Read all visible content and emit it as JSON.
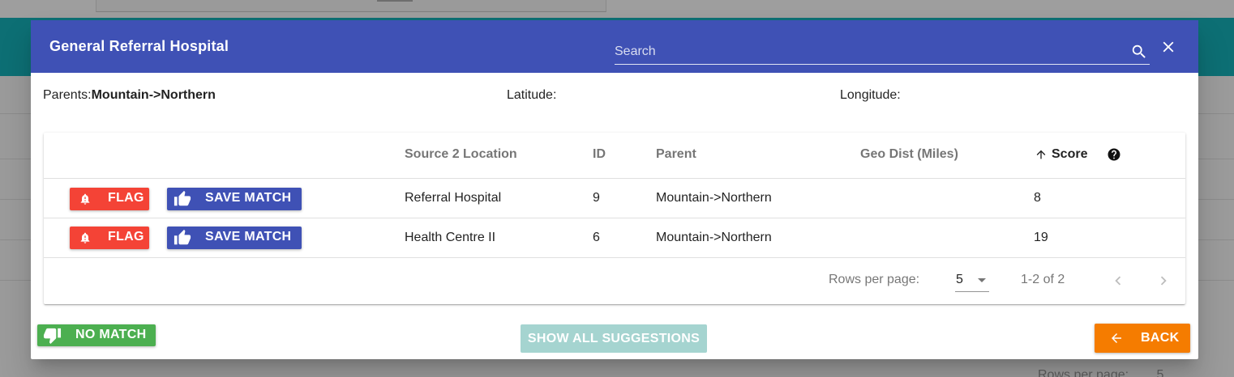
{
  "background": {
    "footer_rows_per_page_label": "Rows per page:",
    "footer_rows_value": "5"
  },
  "dialog": {
    "title": "General Referral Hospital",
    "search": {
      "placeholder": "Search",
      "value": ""
    },
    "icons": {
      "search": "search-icon",
      "close": "close-icon"
    }
  },
  "info": {
    "parents_label": "Parents:",
    "parents_value": "Mountain->Northern",
    "latitude_label": "Latitude:",
    "latitude_value": "",
    "longitude_label": "Longitude:",
    "longitude_value": ""
  },
  "table": {
    "columns": {
      "source_location": "Source 2 Location",
      "id": "ID",
      "parent": "Parent",
      "geo_dist": "Geo Dist (Miles)",
      "score": "Score"
    },
    "sort": {
      "column": "score",
      "direction": "ascending"
    },
    "flag_label": "FLAG",
    "save_label": "SAVE MATCH",
    "rows": [
      {
        "location": "Referral Hospital",
        "id": "9",
        "parent": "Mountain->Northern",
        "geo_dist": "",
        "score": "8"
      },
      {
        "location": "Health Centre II",
        "id": "6",
        "parent": "Mountain->Northern",
        "geo_dist": "",
        "score": "19"
      }
    ],
    "pagination": {
      "rows_per_page_label": "Rows per page:",
      "rows_per_page": "5",
      "range": "1-2 of 2"
    }
  },
  "footer": {
    "no_match_label": "NO MATCH",
    "show_all_label": "SHOW ALL SUGGESTIONS",
    "back_label": "BACK"
  },
  "colors": {
    "toolbar": "#3f51b5",
    "flag": "#f44336",
    "save": "#3f51b5",
    "no_match": "#4caf50",
    "show_all": "#a5d4d0",
    "back": "#f57c00",
    "backdrop_teal": "#0d6f74"
  }
}
